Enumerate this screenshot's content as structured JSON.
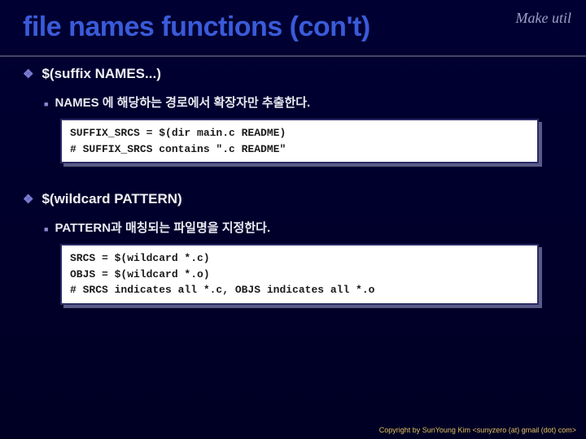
{
  "corner_label": "Make util",
  "title": "file names functions (con't)",
  "section1": {
    "heading": "$(suffix NAMES...)",
    "sub": "NAMES 에 해당하는 경로에서 확장자만 추출한다.",
    "code": "SUFFIX_SRCS = $(dir main.c README)\n# SUFFIX_SRCS contains \".c README\""
  },
  "section2": {
    "heading": "$(wildcard PATTERN)",
    "sub": "PATTERN과 매칭되는 파일명을 지정한다.",
    "code": "SRCS = $(wildcard *.c)\nOBJS = $(wildcard *.o)\n# SRCS indicates all *.c, OBJS indicates all *.o"
  },
  "footer": "Copyright by SunYoung Kim <sunyzero (at) gmail (dot) com>"
}
